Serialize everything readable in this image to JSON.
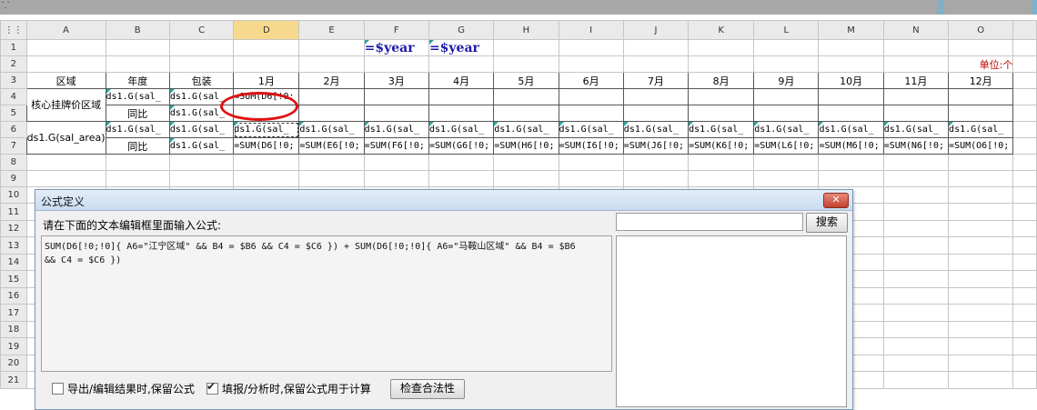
{
  "topbar": {
    "mark": "⸪"
  },
  "columns": [
    "A",
    "B",
    "C",
    "D",
    "E",
    "F",
    "G",
    "H",
    "I",
    "J",
    "K",
    "L",
    "M",
    "N",
    "O"
  ],
  "selected_column": "D",
  "rows": [
    "1",
    "2",
    "3",
    "4",
    "5",
    "6",
    "7",
    "8",
    "9",
    "10",
    "11",
    "12",
    "13",
    "14",
    "15",
    "16",
    "17",
    "18",
    "19",
    "20",
    "21"
  ],
  "cells": {
    "F1": "=$year",
    "G1": "=$year",
    "O2": "单位:个",
    "A3": "区域",
    "B3": "年度",
    "C3": "包装",
    "D3": "1月",
    "E3": "2月",
    "F3": "3月",
    "G3": "4月",
    "H3": "5月",
    "I3": "6月",
    "J3": "7月",
    "K3": "8月",
    "L3": "9月",
    "M3": "10月",
    "N3": "11月",
    "O3": "12月",
    "A4": "核心挂牌价区域",
    "B4": "ds1.G(sal_",
    "C4": "ds1.G(sal_",
    "D4": "=SUM(D6[!0;",
    "B5": "同比",
    "C5": "ds1.G(sal_",
    "A6": "ds1.G(sal_area)",
    "B6": "ds1.G(sal_",
    "C6": "ds1.G(sal_",
    "D6": "ds1.G(sal_",
    "E6": "ds1.G(sal_",
    "F6": "ds1.G(sal_",
    "G6": "ds1.G(sal_",
    "H6": "ds1.G(sal_",
    "I6": "ds1.G(sal_",
    "J6": "ds1.G(sal_",
    "K6": "ds1.G(sal_",
    "L6": "ds1.G(sal_",
    "M6": "ds1.G(sal_",
    "N6": "ds1.G(sal_",
    "O6": "ds1.G(sal_",
    "B7": "同比",
    "C7": "ds1.G(sal_",
    "D7": "=SUM(D6[!0;",
    "E7": "=SUM(E6[!0;",
    "F7": "=SUM(F6[!0;",
    "G7": "=SUM(G6[!0;",
    "H7": "=SUM(H6[!0;",
    "I7": "=SUM(I6[!0;",
    "J7": "=SUM(J6[!0;",
    "K7": "=SUM(K6[!0;",
    "L7": "=SUM(L6[!0;",
    "M7": "=SUM(M6[!0;",
    "N7": "=SUM(N6[!0;",
    "O7": "=SUM(O6[!0;"
  },
  "dialog": {
    "title": "公式定义",
    "close": "✕",
    "prompt": "请在下面的文本编辑框里面输入公式:",
    "formula": "SUM(D6[!0;!0]{ A6=\"江宁区域\" && B4 = $B6 && C4 = $C6 }) + SUM(D6[!0;!0]{ A6=\"马鞍山区域\" && B4 = $B6\n&& C4 = $C6 })",
    "search_value": "",
    "search_button": "搜索",
    "option1_label": "导出/编辑结果时,保留公式",
    "option1_checked": false,
    "option2_label": "填报/分析时,保留公式用于计算",
    "option2_checked": true,
    "check_button": "检查合法性"
  }
}
